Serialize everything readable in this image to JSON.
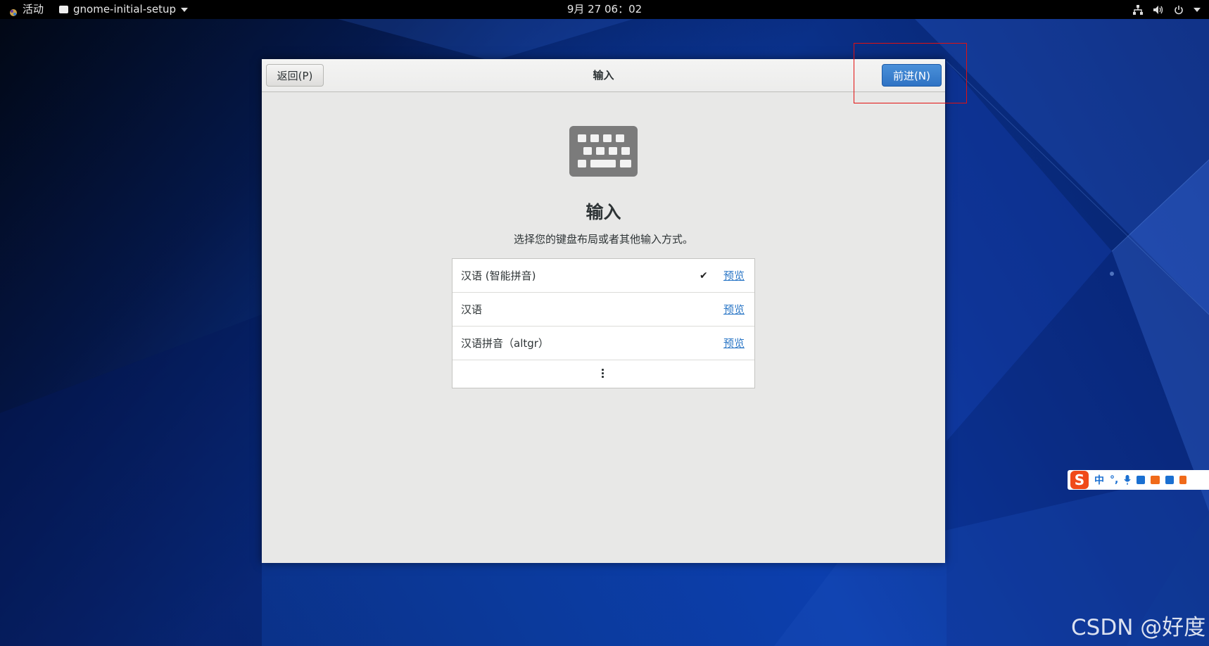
{
  "topbar": {
    "activities": "活动",
    "app_name": "gnome-initial-setup",
    "clock": "9月 27  06：02"
  },
  "dialog": {
    "back_label": "返回(P)",
    "title": "输入",
    "next_label": "前进(N)",
    "heading": "输入",
    "subtitle": "选择您的键盘布局或者其他输入方式。",
    "input_sources": [
      {
        "label": "汉语 (智能拼音)",
        "selected": true,
        "preview": "预览"
      },
      {
        "label": "汉语",
        "selected": false,
        "preview": "预览"
      },
      {
        "label": "汉语拼音（altgr）",
        "selected": false,
        "preview": "预览"
      }
    ],
    "check_mark": "✔"
  },
  "ime_toolbar": {
    "logo": "S",
    "mode": "中",
    "punct": "°,"
  },
  "watermark": "CSDN @好度",
  "colors": {
    "accent": "#3584e4",
    "highlight_box": "#e21010",
    "link": "#2a76c6"
  }
}
